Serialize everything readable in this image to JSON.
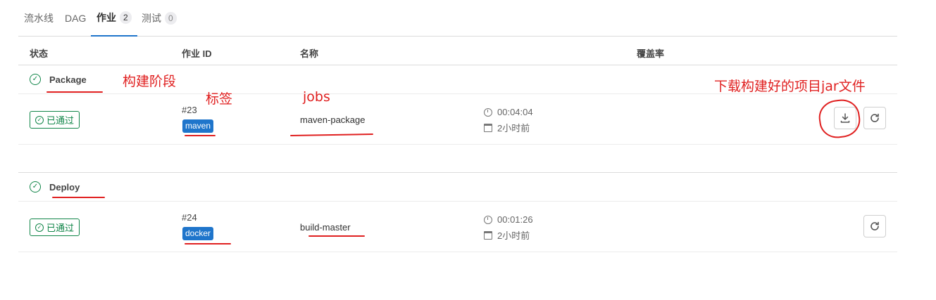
{
  "tabs": [
    {
      "label": "流水线",
      "badge": ""
    },
    {
      "label": "DAG",
      "badge": ""
    },
    {
      "label": "作业",
      "badge": "2"
    },
    {
      "label": "测试",
      "badge": "0"
    }
  ],
  "table_header": {
    "status": "状态",
    "job_id": "作业 ID",
    "name": "名称",
    "coverage": "覆盖率"
  },
  "stages": [
    {
      "name": "Package",
      "job": {
        "status": "已通过",
        "id": "#23",
        "tag": "maven",
        "name": "maven-package",
        "duration": "00:04:04",
        "finished": "2小时前",
        "has_download": true
      }
    },
    {
      "name": "Deploy",
      "job": {
        "status": "已通过",
        "id": "#24",
        "tag": "docker",
        "name": "build-master",
        "duration": "00:01:26",
        "finished": "2小时前",
        "has_download": false
      }
    }
  ],
  "annotations": {
    "stage": "构建阶段",
    "tag": "标签",
    "jobs": "jobs",
    "download": "下载构建好的项目jar文件"
  },
  "colors": {
    "success": "#108548",
    "tag": "#1f75cb",
    "annotation": "#e02020",
    "active_tab": "#1f75cb"
  },
  "icons": {
    "stage_status": "check-circle-icon",
    "duration": "timer-icon",
    "finished": "calendar-icon",
    "download": "download-icon",
    "retry": "retry-icon"
  }
}
